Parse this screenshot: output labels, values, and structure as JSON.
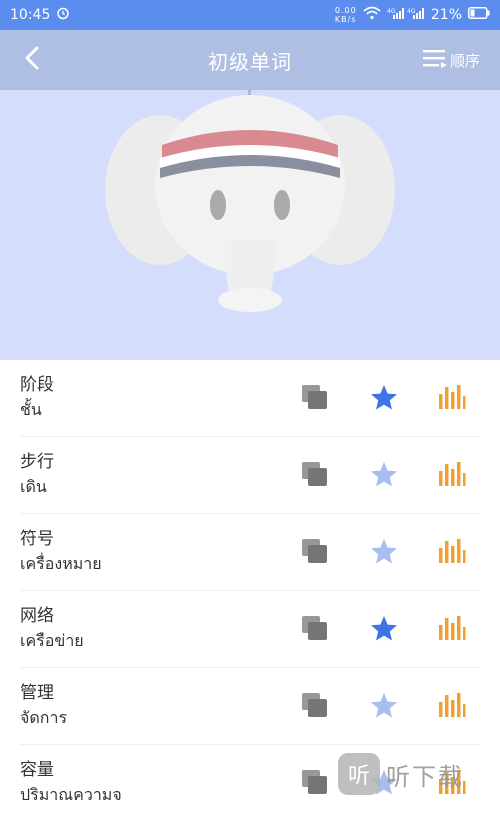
{
  "status_bar": {
    "time": "10:45",
    "alarm_icon": "alarm-clock-icon",
    "network_speed": "0.00 KB/s",
    "signal_icons": "wifi · 4G · 4G",
    "battery": "21%"
  },
  "nav": {
    "back_icon": "chevron-left-icon",
    "title": "初级单词",
    "order_icon": "sort-list-icon",
    "order_label": "顺序"
  },
  "hero": {
    "illustration": "elephant-mascot"
  },
  "words": [
    {
      "chinese": "阶段",
      "thai": "ชั้น",
      "starred": true
    },
    {
      "chinese": "步行",
      "thai": "เดิน",
      "starred": false
    },
    {
      "chinese": "符号",
      "thai": "เครื่องหมาย",
      "starred": false
    },
    {
      "chinese": "网络",
      "thai": "เครือข่าย",
      "starred": true
    },
    {
      "chinese": "管理",
      "thai": "จัดการ",
      "starred": false
    },
    {
      "chinese": "容量",
      "thai": "ปริมาณความจ",
      "starred": false
    }
  ],
  "colors": {
    "star_active": "#3f74e6",
    "star_inactive": "#a9bef0",
    "bars": "#f0a030",
    "copy": "#757575"
  },
  "watermark": {
    "badge": "听",
    "text": "听下载"
  }
}
